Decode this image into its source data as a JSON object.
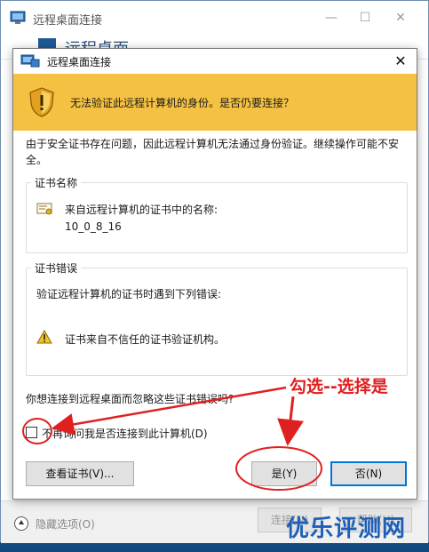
{
  "background_window": {
    "title": "远程桌面连接",
    "header_text": "远程桌面",
    "options_label": "隐藏选项(O)",
    "connect_button": "连接(N)",
    "help_button": "帮助(H)"
  },
  "dialog": {
    "title": "远程桌面连接",
    "close_glyph": "✕",
    "warning": "无法验证此远程计算机的身份。是否仍要连接？",
    "description": "由于安全证书存在问题，因此远程计算机无法通过身份验证。继续操作可能不安全。",
    "cert_name_group": {
      "label": "证书名称",
      "line": "来自远程计算机的证书中的名称:",
      "value": "10_0_8_16"
    },
    "cert_error_group": {
      "label": "证书错误",
      "line": "验证远程计算机的证书时遇到下列错误:",
      "error": "证书来自不信任的证书验证机构。"
    },
    "question": "你想连接到远程桌面而忽略这些证书错误吗?",
    "checkbox": {
      "label": "不再询问我是否连接到此计算机(D)",
      "checked": false
    },
    "buttons": {
      "view_cert": "查看证书(V)...",
      "yes": "是(Y)",
      "no": "否(N)"
    }
  },
  "annotation": {
    "text": "勾选--选择是",
    "color": "#e02020"
  },
  "watermark": {
    "text": "优乐评测网",
    "color": "#1d5fb8"
  },
  "colors": {
    "banner": "#f5c142",
    "default_button_border": "#0078d7"
  }
}
